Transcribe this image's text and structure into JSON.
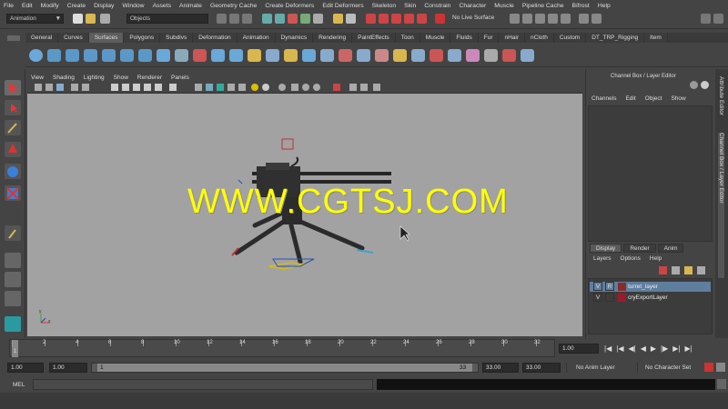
{
  "menu": [
    "File",
    "Edit",
    "Modify",
    "Create",
    "Display",
    "Window",
    "Assets",
    "Animate",
    "Geometry Cache",
    "Create Deformers",
    "Edit Deformers",
    "Skeleton",
    "Skin",
    "Constrain",
    "Character",
    "Muscle",
    "Pipeline Cache",
    "Bifrost",
    "Help"
  ],
  "status": {
    "mode_select": "Animation",
    "selection_field": "Objects",
    "live_surface": "No Live Surface"
  },
  "shelf_tabs": [
    "General",
    "Curves",
    "Surfaces",
    "Polygons",
    "Subdivs",
    "Deformation",
    "Animation",
    "Dynamics",
    "Rendering",
    "PaintEffects",
    "Toon",
    "Muscle",
    "Fluids",
    "Fur",
    "nHair",
    "nCloth",
    "Custom",
    "DT_TRP_Rigging",
    "Item"
  ],
  "shelf_active": "Surfaces",
  "viewport": {
    "menu": [
      "View",
      "Shading",
      "Lighting",
      "Show",
      "Renderer",
      "Panels"
    ],
    "watermark": "WWW.CGTSJ.COM",
    "axis_x": "x",
    "axis_y": "y"
  },
  "channel_box": {
    "title": "Channel Box / Layer Editor",
    "menu": [
      "Channels",
      "Edit",
      "Object",
      "Show"
    ]
  },
  "layer_editor": {
    "tabs": [
      "Display",
      "Render",
      "Anim"
    ],
    "menu": [
      "Layers",
      "Options",
      "Help"
    ],
    "layers": [
      {
        "v": "V",
        "r": "R",
        "name": "turret_layer",
        "color": "#8a2b2b",
        "selected": true
      },
      {
        "v": "V",
        "r": "",
        "name": "cryExportLayer",
        "color": "#9b1b2b",
        "selected": false
      }
    ]
  },
  "side_tabs": [
    "Attribute Editor",
    "Channel Box / Layer Editor"
  ],
  "timeline": {
    "ticks": [
      "1",
      "2",
      "4",
      "6",
      "8",
      "10",
      "12",
      "14",
      "16",
      "18",
      "20",
      "22",
      "24",
      "26",
      "28",
      "30",
      "32"
    ],
    "current_frame": "1.00"
  },
  "range": {
    "start": "1.00",
    "playback_start": "1.00",
    "slider_start": "1",
    "slider_end": "33",
    "playback_end": "33.00",
    "end": "33.00",
    "anim_layer": "No Anim Layer",
    "character_set": "No Character Set"
  },
  "command": {
    "label": "MEL"
  },
  "colors": {
    "viewport_bg": "#a2a2a2",
    "watermark": "#ffff00",
    "ui_bg": "#444444",
    "selected_layer": "#5f7e9e"
  }
}
